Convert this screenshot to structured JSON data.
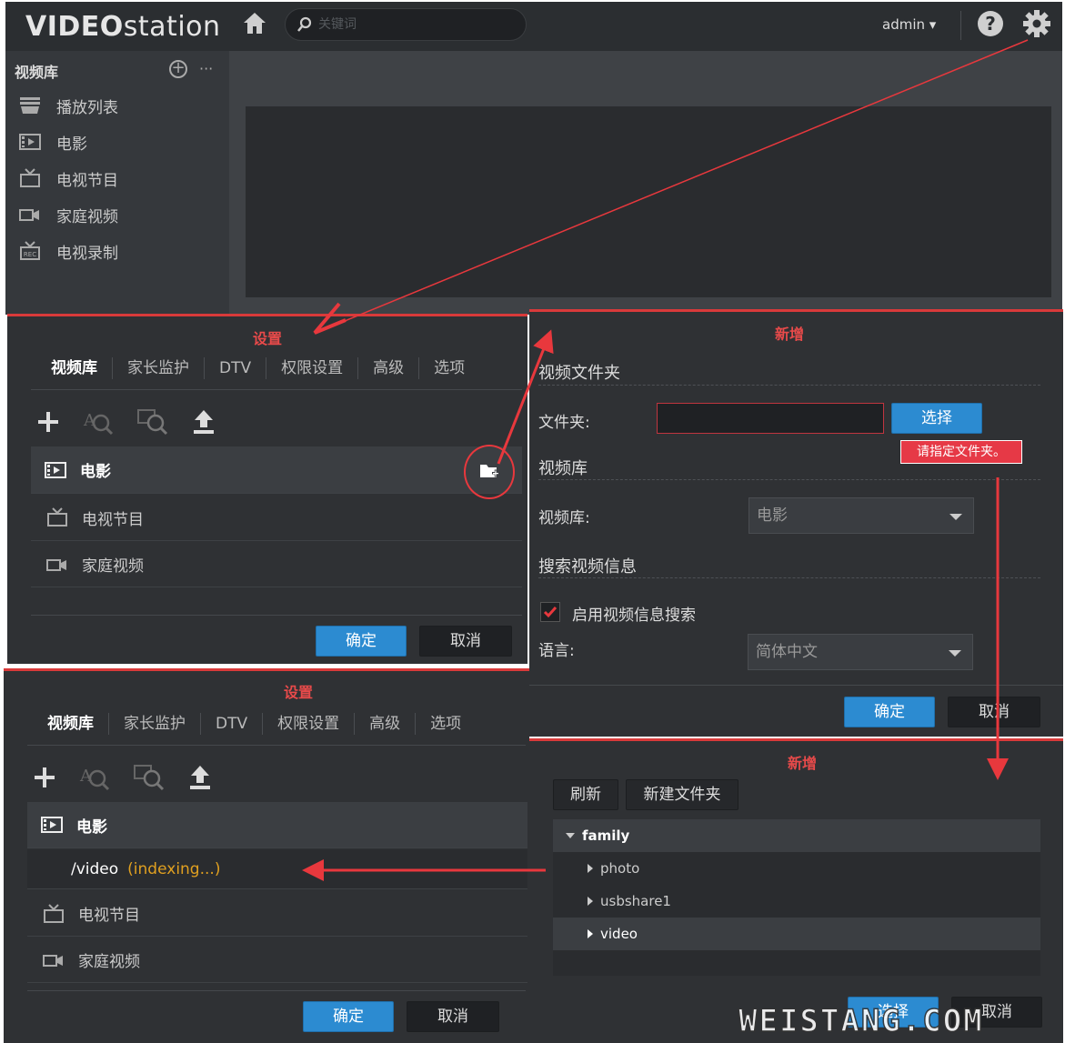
{
  "app": {
    "logo_strong": "VIDEO",
    "logo_light": "station",
    "search_placeholder": "关键词",
    "user": "admin ▾"
  },
  "sidebar": {
    "title": "视频库",
    "items": [
      {
        "label": "播放列表",
        "icon": "playlist-icon"
      },
      {
        "label": "电影",
        "icon": "film-icon"
      },
      {
        "label": "电视节目",
        "icon": "tv-icon"
      },
      {
        "label": "家庭视频",
        "icon": "camcorder-icon"
      },
      {
        "label": "电视录制",
        "icon": "tv-record-icon"
      }
    ]
  },
  "settings": {
    "title": "设置",
    "tabs": [
      "视频库",
      "家长监护",
      "DTV",
      "权限设置",
      "高级",
      "选项"
    ],
    "libraries": [
      "电影",
      "电视节目",
      "家庭视频"
    ],
    "ok": "确定",
    "cancel": "取消",
    "folder_path": "/video",
    "folder_status": "(indexing...)"
  },
  "add_dialog": {
    "title": "新增",
    "section_folder": "视频文件夹",
    "folder_label": "文件夹:",
    "choose_button": "选择",
    "error_tip": "请指定文件夹。",
    "section_library": "视频库",
    "library_label": "视频库:",
    "library_value": "电影",
    "section_search": "搜索视频信息",
    "enable_search": "启用视频信息搜索",
    "language_label": "语言:",
    "language_value": "简体中文",
    "ok": "确定",
    "cancel": "取消"
  },
  "folder_dialog": {
    "title": "新增",
    "refresh": "刷新",
    "new_folder": "新建文件夹",
    "tree_root": "family",
    "tree_children": [
      "photo",
      "usbshare1",
      "video"
    ],
    "select": "选择",
    "cancel": "取消"
  },
  "watermark": "WEISTANG.COM",
  "colors": {
    "accent": "#2c8bd1",
    "annotation": "#e8383d",
    "indexing": "#e0a020"
  }
}
